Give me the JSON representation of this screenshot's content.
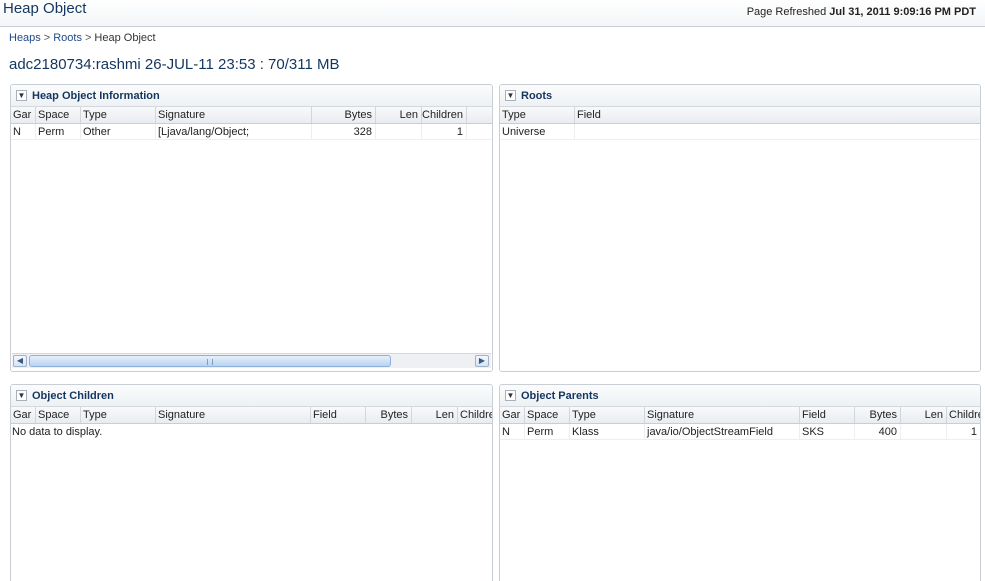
{
  "header": {
    "app_title": "Heap Object",
    "refresh_label": "Page Refreshed",
    "refresh_time": "Jul 31, 2011 9:09:16 PM PDT"
  },
  "breadcrumb": {
    "items": [
      "Heaps",
      "Roots",
      "Heap Object"
    ],
    "separator": ">"
  },
  "page_title": "adc2180734:rashmi 26-JUL-11 23:53 : 70/311 MB",
  "panels": {
    "heap_info": {
      "title": "Heap Object Information",
      "columns": [
        "Gar",
        "Space",
        "Type",
        "Signature",
        "Bytes",
        "Len",
        "Children"
      ],
      "rows": [
        [
          "N",
          "Perm",
          "Other",
          "[Ljava/lang/Object;",
          "328",
          "",
          "1"
        ]
      ]
    },
    "roots": {
      "title": "Roots",
      "columns": [
        "Type",
        "Field"
      ],
      "rows": [
        [
          "Universe",
          ""
        ]
      ]
    },
    "children": {
      "title": "Object Children",
      "columns": [
        "Gar",
        "Space",
        "Type",
        "Signature",
        "Field",
        "Bytes",
        "Len",
        "Childre"
      ],
      "empty_text": "No data to display."
    },
    "parents": {
      "title": "Object Parents",
      "columns": [
        "Gar",
        "Space",
        "Type",
        "Signature",
        "Field",
        "Bytes",
        "Len",
        "Childre"
      ],
      "rows": [
        [
          "N",
          "Perm",
          "Klass",
          "java/io/ObjectStreamField",
          "SKS",
          "400",
          "",
          "1"
        ]
      ]
    }
  },
  "icons": {
    "collapse": "chevron-down-icon",
    "scroll_left": "arrow-left-icon",
    "scroll_right": "arrow-right-icon"
  }
}
